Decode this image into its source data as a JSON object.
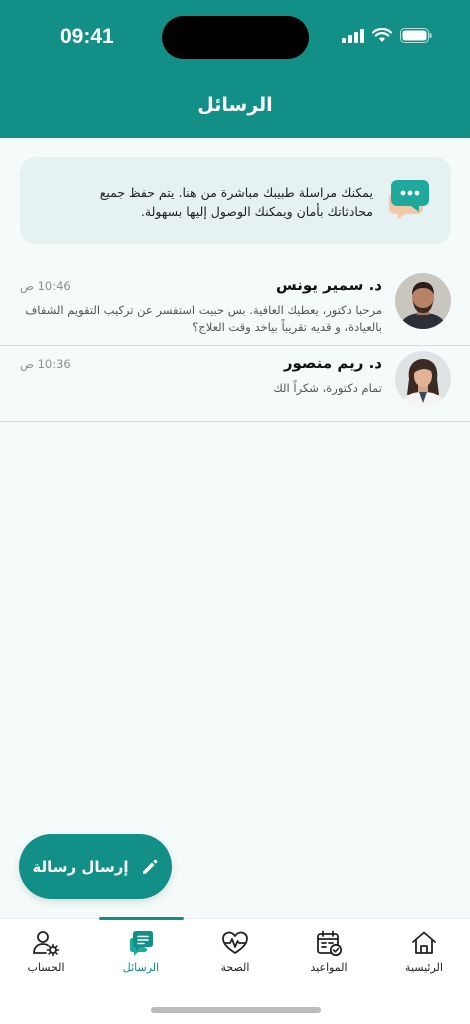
{
  "status_bar": {
    "time": "09:41"
  },
  "header": {
    "title": "الرسائل"
  },
  "info_card": {
    "text": "يمكنك مراسلة طبيبك مباشرة من هنا. يتم حفظ جميع محادثاتك بأمان ويمكنك الوصول إليها بسهولة.",
    "icon": "chat-bubble-icon"
  },
  "conversations": [
    {
      "name": "د. سمير يونس",
      "time": "10:46 ص",
      "preview": "مرحبا دكتور، يعطيك العافية. بس حبيت استفسر عن تركيب التقويم الشفاف بالعيادة، و قديه تقريباً بياخد وقت العلاج؟"
    },
    {
      "name": "د. ريم منصور",
      "time": "10:36 ص",
      "preview": "تمام دكتورة، شكراً الك"
    }
  ],
  "fab": {
    "label": "إرسال رسالة",
    "icon": "pencil-icon"
  },
  "tabbar": {
    "active": "messages",
    "items": [
      {
        "id": "account",
        "label": "الحساب",
        "icon": "user-gear-icon"
      },
      {
        "id": "messages",
        "label": "الرسائل",
        "icon": "messages-icon"
      },
      {
        "id": "health",
        "label": "الصحة",
        "icon": "heart-pulse-icon"
      },
      {
        "id": "appointments",
        "label": "المواعيد",
        "icon": "calendar-check-icon"
      },
      {
        "id": "home",
        "label": "الرئيسية",
        "icon": "home-icon"
      }
    ]
  },
  "colors": {
    "primary": "#128f86",
    "background": "#f4fbfa",
    "card": "#e6f2f1"
  }
}
